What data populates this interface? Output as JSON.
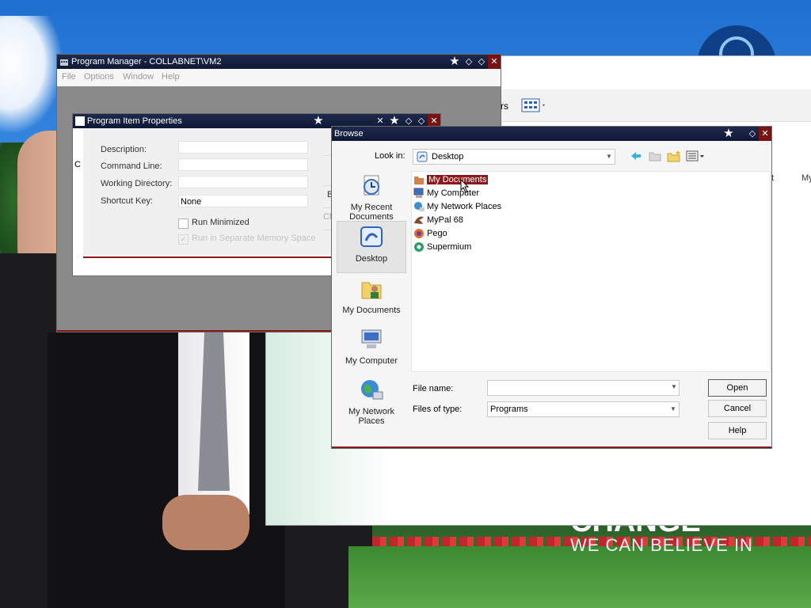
{
  "wallpaper": {
    "slogan": "WE CAN BELIEVE IN",
    "slogan_top": "CHANGE"
  },
  "explorer_bg": {
    "toolbar_frag": "rs",
    "side_frag_1": "t",
    "side_frag_2": "My"
  },
  "program_manager": {
    "title": "Program Manager - COLLABNET\\VM2",
    "menu": [
      "File",
      "Options",
      "Window",
      "Help"
    ]
  },
  "program_item_properties": {
    "title": "Program Item Properties",
    "fields": {
      "description_label": "Description:",
      "command_line_label": "Command Line:",
      "working_directory_label": "Working Directory:",
      "shortcut_key_label": "Shortcut Key:",
      "shortcut_key_value": "None"
    },
    "checkboxes": {
      "run_minimized": "Run Minimized",
      "run_separate": "Run in Separate Memory Space"
    },
    "side_buttons": [
      "B",
      "Cha"
    ],
    "left_frag": "C"
  },
  "browse": {
    "title": "Browse",
    "look_in_label": "Look in:",
    "look_in_value": "Desktop",
    "places": [
      "My Recent Documents",
      "Desktop",
      "My Documents",
      "My Computer",
      "My Network Places"
    ],
    "files": [
      "My Documents",
      "My Computer",
      "My Network Places",
      "MyPal 68",
      "Pego",
      "Supermium"
    ],
    "file_name_label": "File name:",
    "file_name_value": "",
    "files_of_type_label": "Files of type:",
    "files_of_type_value": "Programs",
    "buttons": {
      "open": "Open",
      "cancel": "Cancel",
      "help": "Help"
    }
  },
  "colors": {
    "titlebar": "#0e1735",
    "accent_red": "#8a1a1a"
  }
}
